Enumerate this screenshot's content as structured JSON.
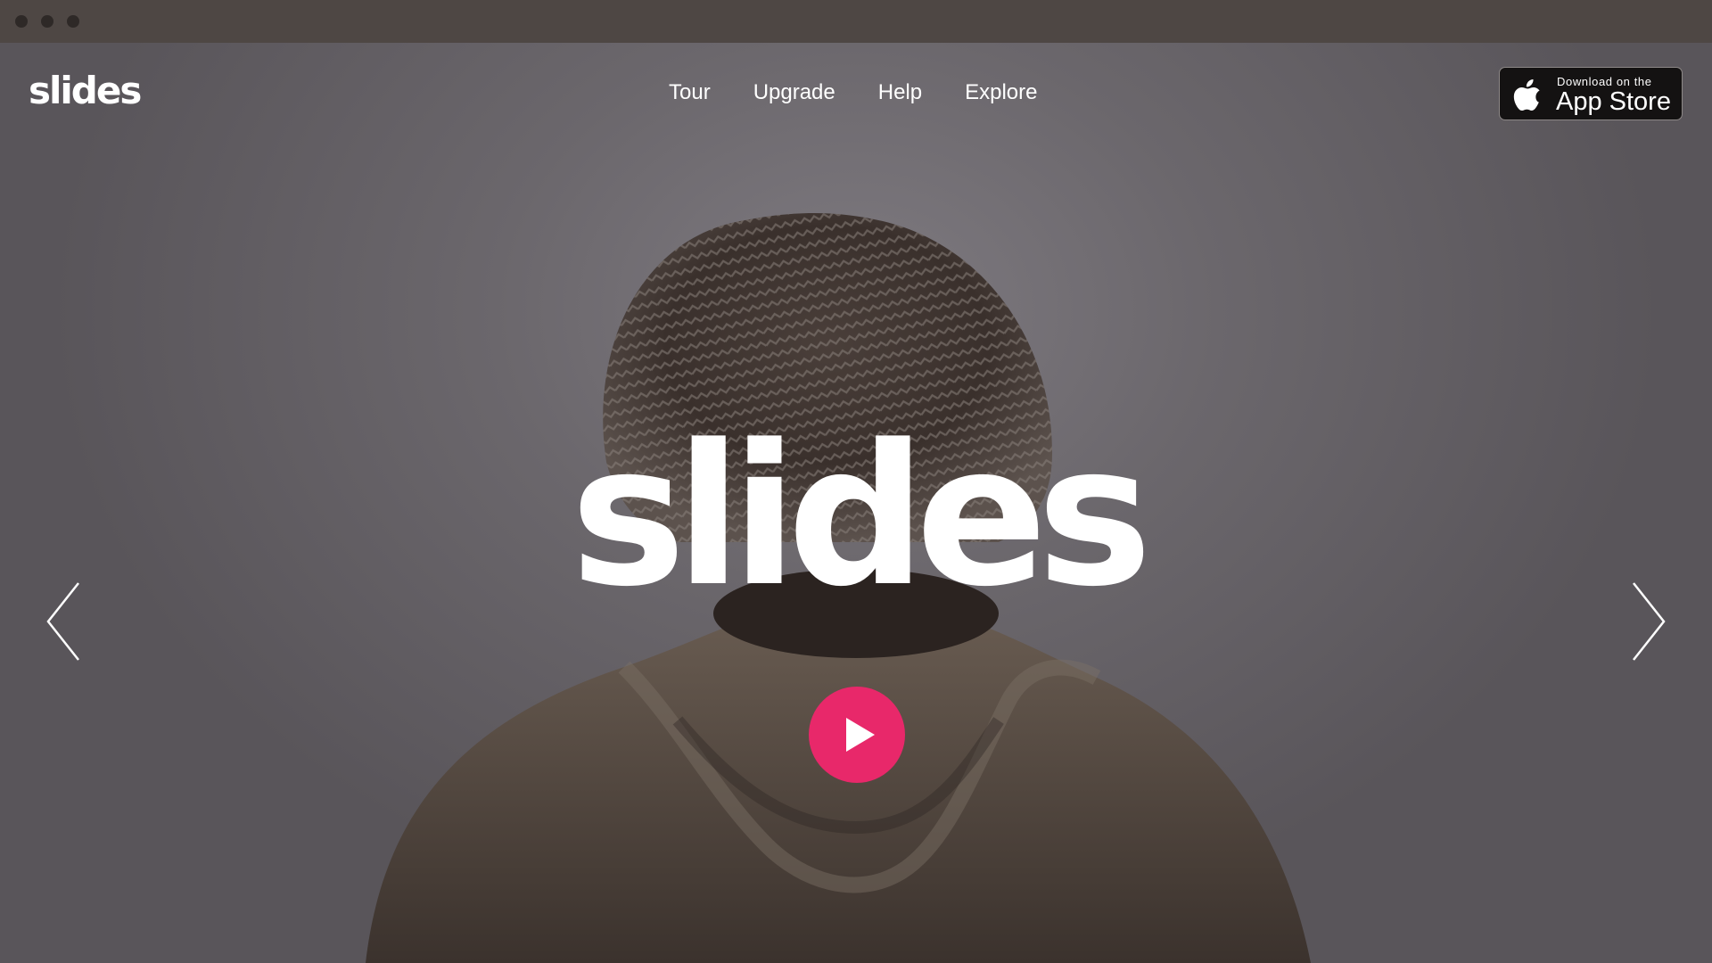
{
  "window": {
    "controls": [
      "close-dot",
      "minimize-dot",
      "maximize-dot"
    ]
  },
  "header": {
    "logo_text": "slides",
    "nav": [
      {
        "label": "Tour"
      },
      {
        "label": "Upgrade"
      },
      {
        "label": "Help"
      },
      {
        "label": "Explore"
      }
    ],
    "appstore": {
      "small_text": "Download on the",
      "big_text": "App Store",
      "icon": "apple-icon"
    }
  },
  "hero": {
    "title": "slides",
    "prev_icon": "chevron-left-icon",
    "next_icon": "chevron-right-icon",
    "play_icon": "play-icon",
    "play_color": "#e8286a"
  },
  "colors": {
    "titlebar": "#4e4744",
    "background": "#6b676c",
    "accent": "#e8286a",
    "text": "#ffffff"
  }
}
